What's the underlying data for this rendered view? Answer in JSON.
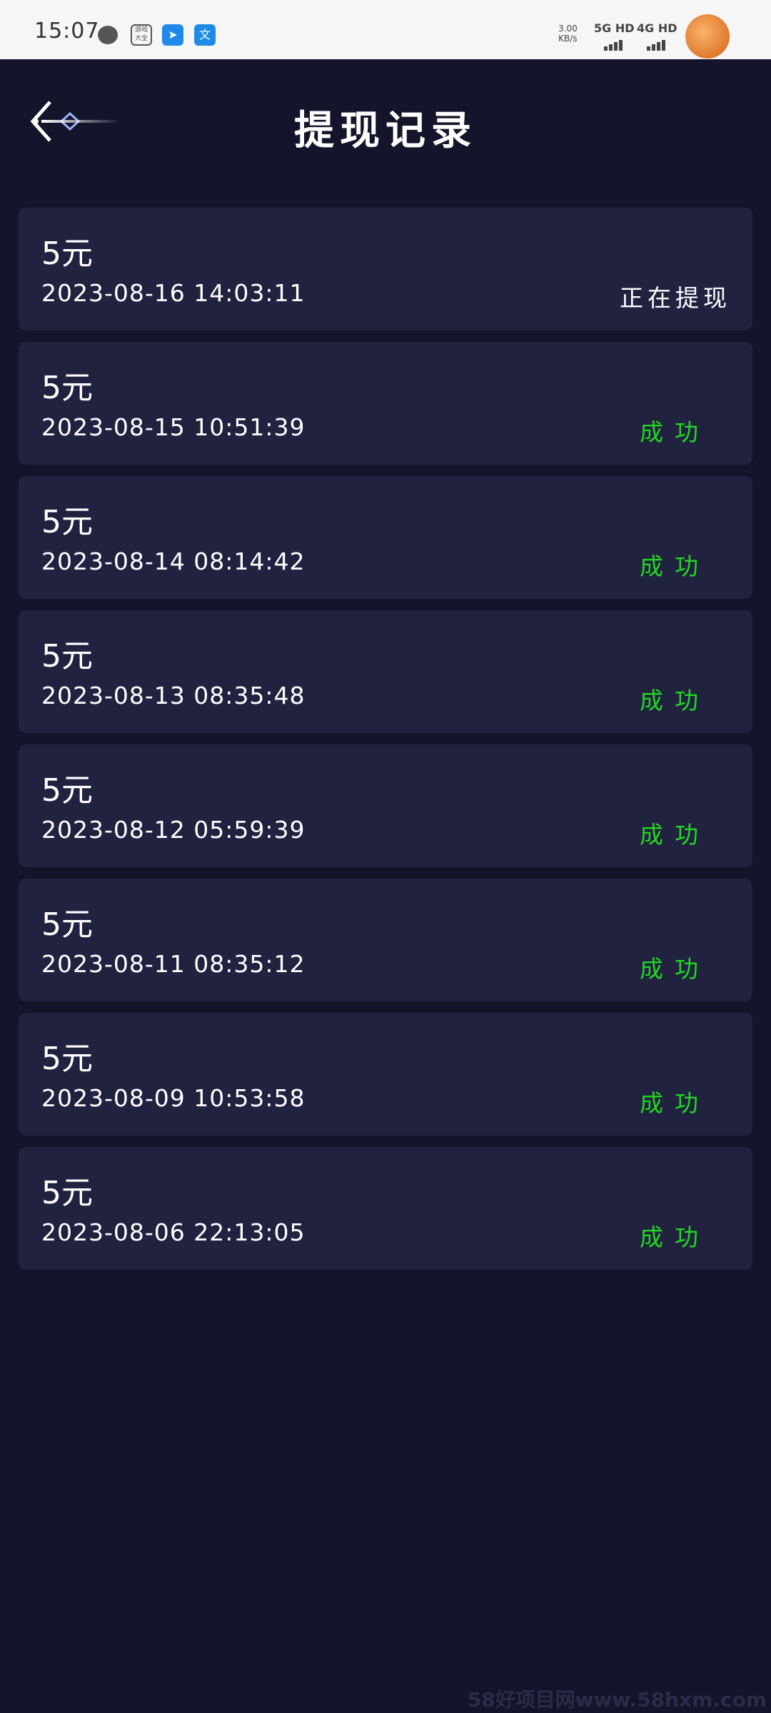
{
  "status_bar": {
    "time": "15:07",
    "icons": [
      "message-icon",
      "game-box-icon",
      "blue-app-icon",
      "translate-icon"
    ],
    "speed_value": "3.00",
    "speed_unit": "KB/s",
    "network1": "5G HD",
    "network2": "4G HD"
  },
  "header": {
    "title": "提现记录",
    "back_icon": "back-arrow-icon"
  },
  "colors": {
    "background": "#14152a",
    "card": "#202240",
    "success": "#22d61f",
    "pending": "#ffffff"
  },
  "records": [
    {
      "amount": "5元",
      "time": "2023-08-16 14:03:11",
      "status": "正在提现",
      "state": "pending"
    },
    {
      "amount": "5元",
      "time": "2023-08-15 10:51:39",
      "status": "成功",
      "state": "ok"
    },
    {
      "amount": "5元",
      "time": "2023-08-14 08:14:42",
      "status": "成功",
      "state": "ok"
    },
    {
      "amount": "5元",
      "time": "2023-08-13 08:35:48",
      "status": "成功",
      "state": "ok"
    },
    {
      "amount": "5元",
      "time": "2023-08-12 05:59:39",
      "status": "成功",
      "state": "ok"
    },
    {
      "amount": "5元",
      "time": "2023-08-11 08:35:12",
      "status": "成功",
      "state": "ok"
    },
    {
      "amount": "5元",
      "time": "2023-08-09 10:53:58",
      "status": "成功",
      "state": "ok"
    },
    {
      "amount": "5元",
      "time": "2023-08-06 22:13:05",
      "status": "成功",
      "state": "ok"
    }
  ],
  "watermark": "58好项目网www.58hxm.com"
}
